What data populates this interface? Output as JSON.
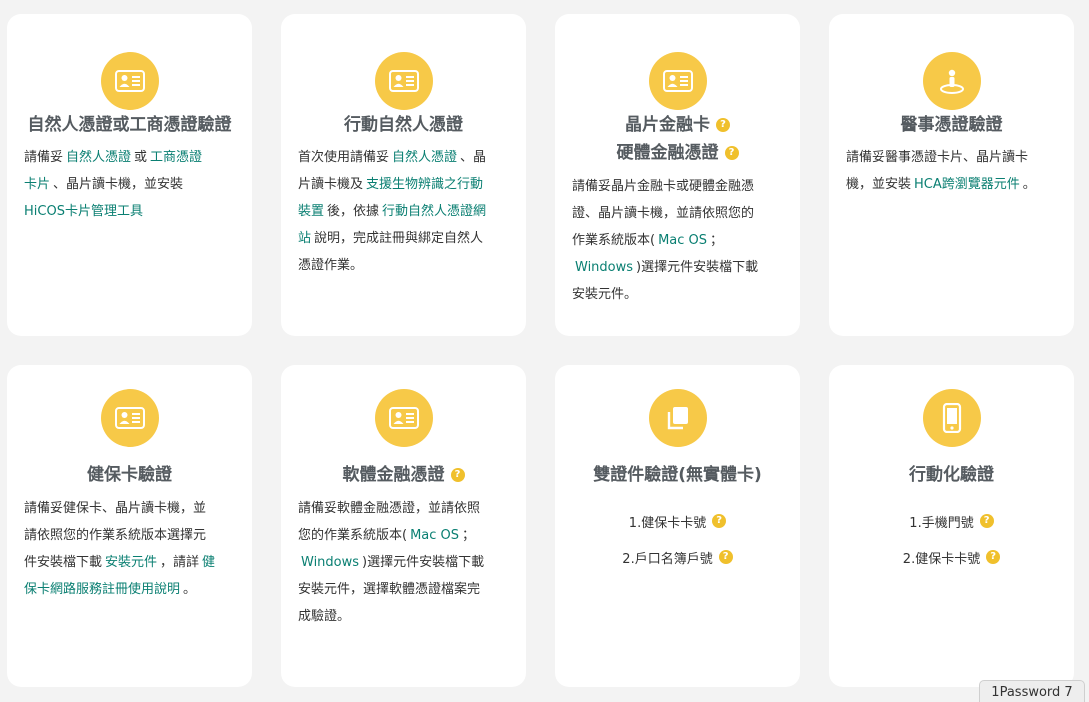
{
  "cards": {
    "c1": {
      "icon": "id-card-icon",
      "title": "自然人憑證或工商憑證驗證",
      "desc": {
        "t1": "請備妥",
        "l1": "自然人憑證",
        "t2": "或",
        "l2": "工商憑證",
        "l3": "卡片",
        "t3": "、晶片讀卡機，並安裝",
        "l4": "HiCOS卡片管理工具"
      }
    },
    "c2": {
      "icon": "id-card-icon",
      "title": "行動自然人憑證",
      "desc": {
        "t1": "首次使用請備妥",
        "l1": "自然人憑證",
        "t2": "、晶",
        "t3": "片讀卡機及",
        "l2": "支援生物辨識之行動",
        "l3": "裝置",
        "t4": "後，依據",
        "l4": "行動自然人憑證網",
        "l5": "站",
        "t5": "說明，完成註冊與綁定自然人",
        "t6": "憑證作業。"
      }
    },
    "c3": {
      "icon": "id-card-icon",
      "title1": "晶片金融卡",
      "title2": "硬體金融憑證",
      "desc": {
        "t1": "請備妥晶片金融卡或硬體金融憑",
        "t2": "證、晶片讀卡機，並請依照您的",
        "t3": "作業系統版本(",
        "l1": "Mac OS",
        "t4": "；",
        "l2": "Windows",
        "t5": ")選擇元件安裝檔下載",
        "t6": "安裝元件。"
      }
    },
    "c4": {
      "icon": "person-pin-icon",
      "title": "醫事憑證驗證",
      "desc": {
        "t1": "請備妥醫事憑證卡片、晶片讀卡",
        "t2": "機，並安裝",
        "l1": "HCA跨瀏覽器元件",
        "t3": "。"
      }
    },
    "c5": {
      "icon": "id-card-icon",
      "title": "健保卡驗證",
      "desc": {
        "t1": "請備妥健保卡、晶片讀卡機，並",
        "t2": "請依照您的作業系統版本選擇元",
        "t3": "件安裝檔下載",
        "l1": "安裝元件",
        "t4": "，請詳",
        "l2": "健",
        "l3": "保卡網路服務註冊使用說明",
        "t5": "。"
      }
    },
    "c6": {
      "icon": "id-card-icon",
      "title": "軟體金融憑證",
      "desc": {
        "t1": "請備妥軟體金融憑證，並請依照",
        "t2": "您的作業系統版本(",
        "l1": "Mac OS",
        "t3": "；",
        "l2": "Windows",
        "t4": ")選擇元件安裝檔下載",
        "t5": "安裝元件，選擇軟體憑證檔案完",
        "t6": "成驗證。"
      }
    },
    "c7": {
      "icon": "copy-icon",
      "title": "雙證件驗證(無實體卡)",
      "items": [
        "1.健保卡卡號",
        "2.戶口名簿戶號"
      ]
    },
    "c8": {
      "icon": "mobile-phone-icon",
      "title": "行動化驗證",
      "items": [
        "1.手機門號",
        "2.健保卡卡號"
      ]
    }
  },
  "help_glyph": "?",
  "password_manager": {
    "label": "1Password 7"
  },
  "colors": {
    "accent": "#f7c948",
    "link": "#0a7f72",
    "title": "#555b60"
  }
}
